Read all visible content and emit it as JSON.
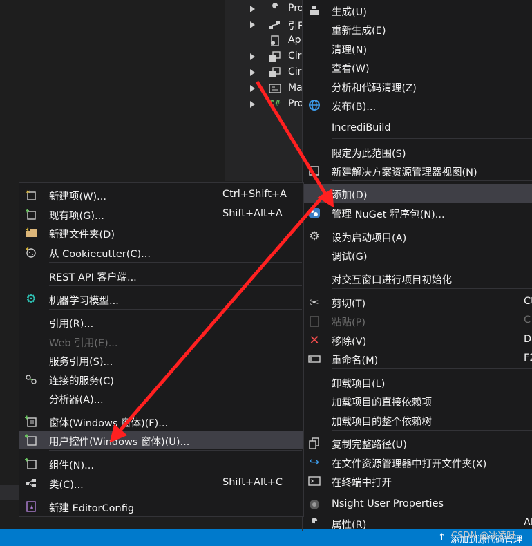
{
  "solution_tree": [
    {
      "label": "Pro",
      "icon": "wrench-icon",
      "expander": true
    },
    {
      "label": "引F",
      "icon": "references-icon",
      "expander": true
    },
    {
      "label": "Ap",
      "icon": "config-file-icon",
      "expander": false
    },
    {
      "label": "Cir",
      "icon": "form-icon",
      "expander": true
    },
    {
      "label": "Cir",
      "icon": "form-icon",
      "expander": true
    },
    {
      "label": "Ma",
      "icon": "class-file-icon",
      "expander": true
    },
    {
      "label": "Pro",
      "icon": "csharp-file-icon",
      "expander": true
    }
  ],
  "context_menu": {
    "build": "生成(U)",
    "rebuild": "重新生成(E)",
    "clean": "清理(N)",
    "view": "查看(W)",
    "analyze": "分析和代码清理(Z)",
    "publish": "发布(B)...",
    "incredibuild": "IncrediBuild",
    "scope": "限定为此范围(S)",
    "new_view": "新建解决方案资源管理器视图(N)",
    "add": "添加(D)",
    "nuget": "管理 NuGet 程序包(N)...",
    "startup": "设为启动项目(A)",
    "debug": "调试(G)",
    "interactive": "对交互窗口进行项目初始化",
    "cut": "剪切(T)",
    "cut_shortcut": "Ct",
    "paste": "粘贴(P)",
    "paste_shortcut": "C",
    "remove": "移除(V)",
    "remove_shortcut": "De",
    "rename": "重命名(M)",
    "rename_shortcut": "F2",
    "unload": "卸载项目(L)",
    "load_direct": "加载项目的直接依赖项",
    "load_tree": "加载项目的整个依赖树",
    "copy_path": "复制完整路径(U)",
    "open_folder": "在文件资源管理器中打开文件夹(X)",
    "open_terminal": "在终端中打开",
    "nsight": "Nsight User Properties",
    "properties": "属性(R)",
    "properties_shortcut": "Al"
  },
  "add_submenu": {
    "new_item": "新建项(W)...",
    "new_item_shortcut": "Ctrl+Shift+A",
    "existing_item": "现有项(G)...",
    "existing_item_shortcut": "Shift+Alt+A",
    "new_folder": "新建文件夹(D)",
    "cookiecutter": "从 Cookiecutter(C)...",
    "rest_api": "REST API 客户端...",
    "ml_model": "机器学习模型...",
    "reference": "引用(R)...",
    "web_reference": "Web 引用(E)...",
    "service_reference": "服务引用(S)...",
    "connected_service": "连接的服务(C)",
    "analyzer": "分析器(A)...",
    "form": "窗体(Windows 窗体)(F)...",
    "user_control": "用户控件(Windows 窗体)(U)...",
    "component": "组件(N)...",
    "class": "类(C)...",
    "class_shortcut": "Shift+Alt+C",
    "editorconfig": "新建 EditorConfig"
  },
  "status_bar": {
    "text": "添加到源代码管理",
    "arrow": "↑"
  },
  "watermark": "CSDN @冰凌呀",
  "colors": {
    "menu_bg": "#1b1b1c",
    "highlight": "#3f3f46",
    "status_blue": "#007acc",
    "annotation_red": "#ff2020",
    "disabled_text": "#6d6d6d"
  }
}
